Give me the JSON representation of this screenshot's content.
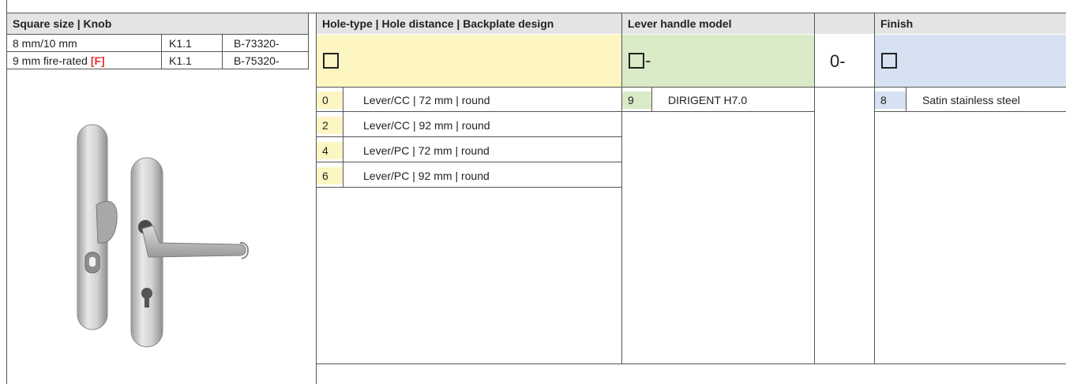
{
  "headers": {
    "square_knob": "Square size | Knob",
    "hole_type": "Hole-type | Hole distance | Backplate design",
    "lever_model": "Lever handle model",
    "finish": "Finish"
  },
  "square_rows": [
    {
      "size": "8 mm/10 mm",
      "size_note": "",
      "knob": "K1.1",
      "article": "B-73320-"
    },
    {
      "size": "9 mm fire-rated ",
      "size_note": "[F]",
      "knob": "K1.1",
      "article": "B-75320-"
    }
  ],
  "selectors": {
    "hole_type_box": "☐",
    "lever_suffix": "-",
    "separator": "0-"
  },
  "hole_type_options": [
    {
      "code": "0",
      "label": "Lever/CC | 72 mm | round"
    },
    {
      "code": "2",
      "label": "Lever/CC | 92 mm | round"
    },
    {
      "code": "4",
      "label": "Lever/PC | 72 mm | round"
    },
    {
      "code": "6",
      "label": "Lever/PC | 92 mm | round"
    }
  ],
  "lever_options": [
    {
      "code": "9",
      "label": "DIRIGENT H7.0"
    }
  ],
  "finish_options": [
    {
      "code": "8",
      "label": "Satin stainless steel"
    }
  ],
  "colors": {
    "header_bg": "#e4e4e4",
    "hole_type_bg": "#fdf6c3",
    "lever_bg": "#d9ebc6",
    "finish_bg": "#d6e2f2",
    "fire_red": "#e8322d"
  }
}
